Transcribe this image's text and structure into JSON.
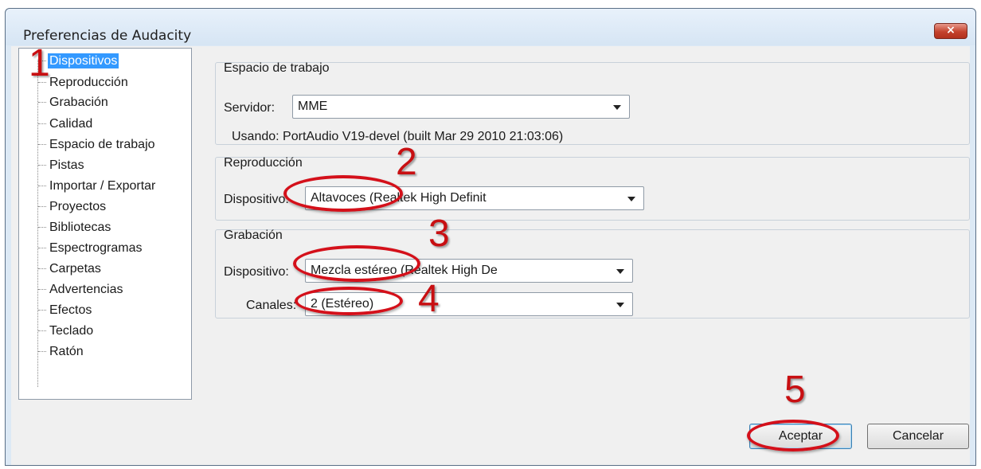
{
  "window": {
    "title": "Preferencias de Audacity",
    "close_label": "×"
  },
  "sidebar": {
    "items": [
      {
        "label": "Dispositivos",
        "selected": true
      },
      {
        "label": "Reproducción"
      },
      {
        "label": "Grabación"
      },
      {
        "label": "Calidad"
      },
      {
        "label": "Espacio de trabajo"
      },
      {
        "label": "Pistas"
      },
      {
        "label": "Importar / Exportar"
      },
      {
        "label": "Proyectos"
      },
      {
        "label": "Bibliotecas"
      },
      {
        "label": "Espectrogramas"
      },
      {
        "label": "Carpetas"
      },
      {
        "label": "Advertencias"
      },
      {
        "label": "Efectos"
      },
      {
        "label": "Teclado"
      },
      {
        "label": "Ratón"
      }
    ]
  },
  "interface": {
    "group_title": "Espacio de trabajo",
    "host_label": "Servidor:",
    "host_value": "MME",
    "using_text": "Usando: PortAudio V19-devel (built Mar 29 2010 21:03:06)"
  },
  "playback": {
    "group_title": "Reproducción",
    "device_label": "Dispositivo:",
    "device_value": "Altavoces (Realtek High Definit"
  },
  "recording": {
    "group_title": "Grabación",
    "device_label": "Dispositivo:",
    "device_value": "Mezcla estéreo (Realtek High De",
    "channels_label": "Canales:",
    "channels_value": "2 (Estéreo)"
  },
  "buttons": {
    "ok": "Aceptar",
    "cancel": "Cancelar"
  },
  "annotations": {
    "n1": "1",
    "n2": "2",
    "n3": "3",
    "n4": "4",
    "n5": "5",
    "color": "#c80f12"
  },
  "colors": {
    "selection": "#3399ff",
    "window_frame": "#dce9f5",
    "close_button": "#c4422d"
  }
}
